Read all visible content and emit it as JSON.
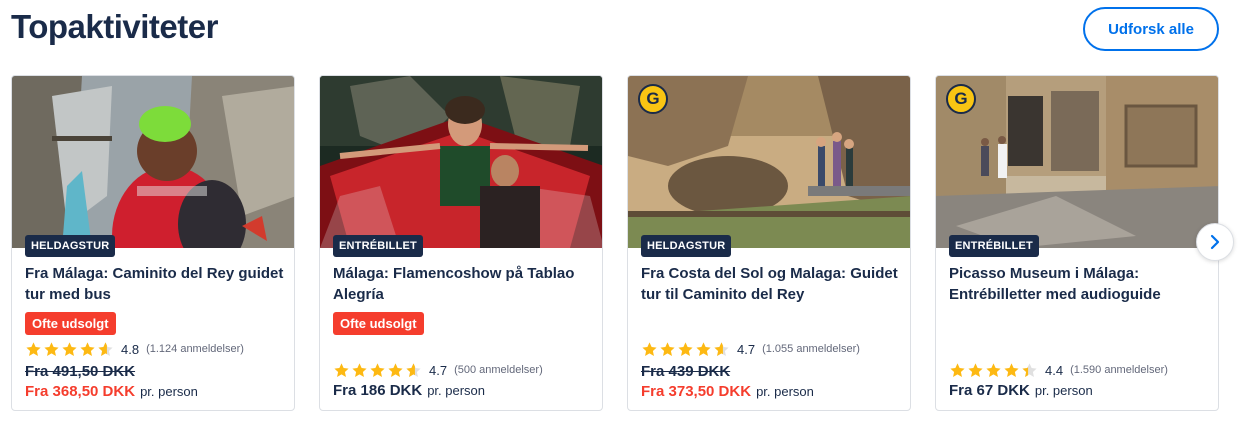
{
  "header": {
    "title": "Topaktiviteter",
    "explore_label": "Udforsk alle"
  },
  "cards": [
    {
      "badge": "HELDAGSTUR",
      "title": "Fra Málaga: Caminito del Rey guidet tur med bus",
      "sellout": "Ofte udsolgt",
      "rating": "4.8",
      "reviews": "(1.124 anmeldelser)",
      "old_price": "Fra 491,50 DKK",
      "price": "Fra 368,50 DKK",
      "per": "pr. person",
      "image": "hiker-with-helmet-on-cliff-walkway"
    },
    {
      "badge": "ENTRÉBILLET",
      "title": "Málaga: Flamencoshow på Tablao Alegría",
      "sellout": "Ofte udsolgt",
      "rating": "4.7",
      "reviews": "(500 anmeldelser)",
      "price": "Fra 186 DKK",
      "per": "pr. person",
      "image": "flamenco-dancers-with-shawl"
    },
    {
      "badge": "HELDAGSTUR",
      "title": "Fra Costa del Sol og Malaga: Guidet tur til Caminito del Rey",
      "rating": "4.7",
      "reviews": "(1.055 anmeldelser)",
      "old_price": "Fra 439 DKK",
      "price": "Fra 373,50 DKK",
      "per": "pr. person",
      "logo": "G",
      "image": "rocky-gorge-boardwalk"
    },
    {
      "badge": "ENTRÉBILLET",
      "title": "Picasso Museum i Málaga: Entrébilletter med audioguide",
      "rating": "4.4",
      "reviews": "(1.590 anmeldelser)",
      "price": "Fra 67 DKK",
      "per": "pr. person",
      "logo": "G",
      "image": "museum-stone-courtyard"
    }
  ],
  "colors": {
    "brand_navy": "#1a2b49",
    "accent_blue": "#0071eb",
    "sale_red": "#f53d2d",
    "star_yellow": "#fdb913"
  },
  "icons": {
    "star": "star-icon",
    "half_star": "half-star-icon",
    "next": "chevron-right-icon",
    "logo": "getyourguide-g-logo"
  }
}
